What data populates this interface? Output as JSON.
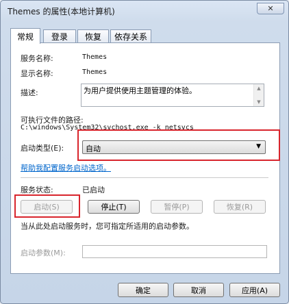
{
  "window": {
    "title": "Themes 的属性(本地计算机)",
    "close_glyph": "✕"
  },
  "tabs": [
    {
      "label": "常规",
      "active": true
    },
    {
      "label": "登录",
      "active": false
    },
    {
      "label": "恢复",
      "active": false
    },
    {
      "label": "依存关系",
      "active": false
    }
  ],
  "general": {
    "service_name_label": "服务名称:",
    "service_name_value": "Themes",
    "display_name_label": "显示名称:",
    "display_name_value": "Themes",
    "description_label": "描述:",
    "description_value": "为用户提供使用主题管理的体验。",
    "exe_path_label": "可执行文件的路径:",
    "exe_path_value": "C:\\windows\\System32\\svchost.exe -k netsvcs",
    "startup_type_label": "启动类型(E):",
    "startup_type_value": "自动",
    "help_link": "帮助我配置服务启动选项。",
    "service_status_label": "服务状态:",
    "service_status_value": "已启动",
    "buttons": {
      "start": "启动(S)",
      "stop": "停止(T)",
      "pause": "暂停(P)",
      "resume": "恢复(R)"
    },
    "hint": "当从此处启动服务时，您可指定所适用的启动参数。",
    "start_params_label": "启动参数(M):",
    "start_params_value": ""
  },
  "footer": {
    "ok": "确定",
    "cancel": "取消",
    "apply": "应用(A)"
  },
  "colors": {
    "highlight": "#d8242c",
    "link": "#0066cc"
  }
}
